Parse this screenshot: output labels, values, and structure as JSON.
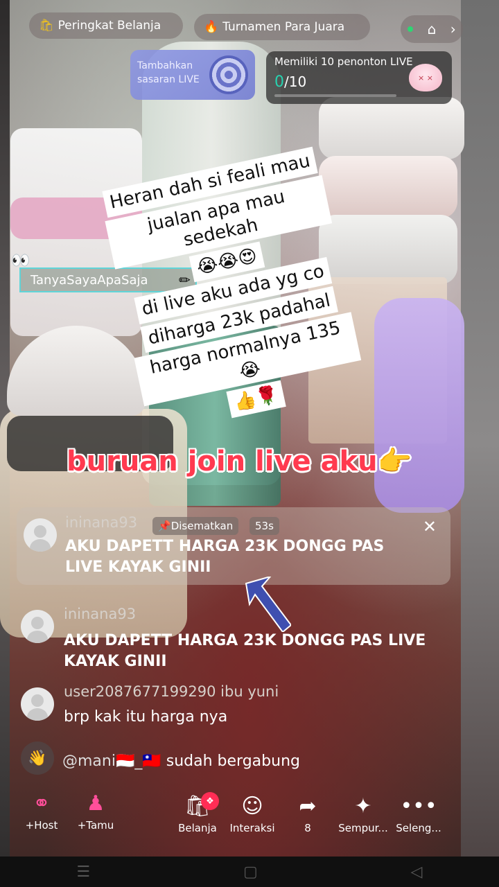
{
  "top": {
    "pill_rank": "Peringkat Belanja",
    "pill_tournament": "Turnamen Para Juara"
  },
  "goal_card": {
    "text": "Tambahkan sasaran LIVE"
  },
  "viewer_card": {
    "title": "Memiliki 10 penonton LIVE",
    "current": "0",
    "target": "/10"
  },
  "tag": {
    "label": "TanyaSayaApaSaja"
  },
  "sticker": {
    "lines": [
      "Heran dah si feali mau",
      "jualan apa mau sedekah",
      "😭😭😍",
      "di live aku ada yg co",
      "diharga 23k padahal",
      "harga normalnya 135😭",
      "👍🌹"
    ]
  },
  "overlay_text": "buruan join live aku👉",
  "pinned": {
    "user": "ininana93",
    "badge": "Disematkan",
    "time": "53s",
    "text": "AKU DAPETT HARGA 23K DONGG PAS LIVE KAYAK GINII"
  },
  "comments": [
    {
      "user": "ininana93",
      "text": "AKU DAPETT HARGA 23K DONGG PAS LIVE KAYAK GINII"
    },
    {
      "user": "user2087677199290 ibu yuni",
      "text": "brp kak itu harga nya"
    }
  ],
  "joined": {
    "user": "@mani🇮🇩_🇹🇼",
    "text": "sudah bergabung"
  },
  "bottom": {
    "host": "+Host",
    "guest": "+Tamu",
    "shop": "Belanja",
    "interaction": "Interaksi",
    "share_count": "8",
    "effects": "Sempur...",
    "more": "Seleng..."
  },
  "colors": {
    "accent_red": "#ff3a4f",
    "viewer_green": "#27d3b0",
    "shop_badge": "#ff2d55"
  },
  "icons": [
    "shopping-bag-icon",
    "flame-icon",
    "home-play-icon",
    "chevron-right-icon",
    "target-icon",
    "eyes-icon",
    "pencil-icon",
    "pin-icon",
    "close-icon",
    "arrow-icon",
    "wave-hand-icon",
    "host-icon",
    "guest-icon",
    "shop-icon",
    "interaction-icon",
    "share-icon",
    "magic-wand-icon",
    "more-icon"
  ]
}
